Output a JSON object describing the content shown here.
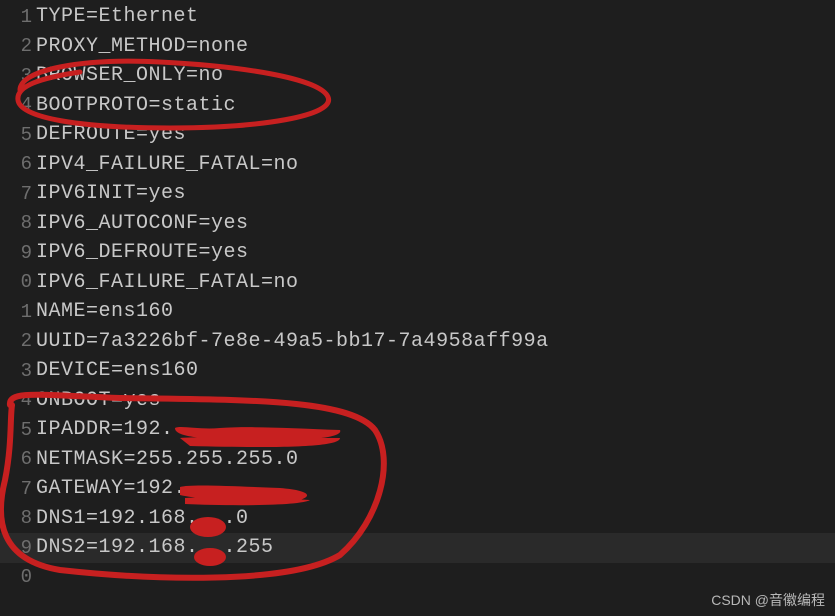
{
  "lines": [
    {
      "num": "1",
      "content": "TYPE=Ethernet"
    },
    {
      "num": "2",
      "content": "PROXY_METHOD=none"
    },
    {
      "num": "3",
      "content": "BROWSER_ONLY=no"
    },
    {
      "num": "4",
      "content": "BOOTPROTO=static"
    },
    {
      "num": "5",
      "content": "DEFROUTE=yes"
    },
    {
      "num": "6",
      "content": "IPV4_FAILURE_FATAL=no"
    },
    {
      "num": "7",
      "content": "IPV6INIT=yes"
    },
    {
      "num": "8",
      "content": "IPV6_AUTOCONF=yes"
    },
    {
      "num": "9",
      "content": "IPV6_DEFROUTE=yes"
    },
    {
      "num": "0",
      "content": "IPV6_FAILURE_FATAL=no"
    },
    {
      "num": "1",
      "content": "NAME=ens160"
    },
    {
      "num": "2",
      "content": "UUID=7a3226bf-7e8e-49a5-bb17-7a4958aff99a"
    },
    {
      "num": "3",
      "content": "DEVICE=ens160"
    },
    {
      "num": "4",
      "content": "ONBOOT=yes"
    },
    {
      "num": "5",
      "content": "IPADDR=192."
    },
    {
      "num": "6",
      "content": "NETMASK=255.255.255.0"
    },
    {
      "num": "7",
      "content": "GATEWAY=192."
    },
    {
      "num": "8",
      "content": "DNS1=192.168.  .0"
    },
    {
      "num": "9",
      "content": "DNS2=192.168.  .255"
    },
    {
      "num": "0",
      "content": ""
    }
  ],
  "watermark": "CSDN @音徽编程",
  "highlight_index": 18
}
